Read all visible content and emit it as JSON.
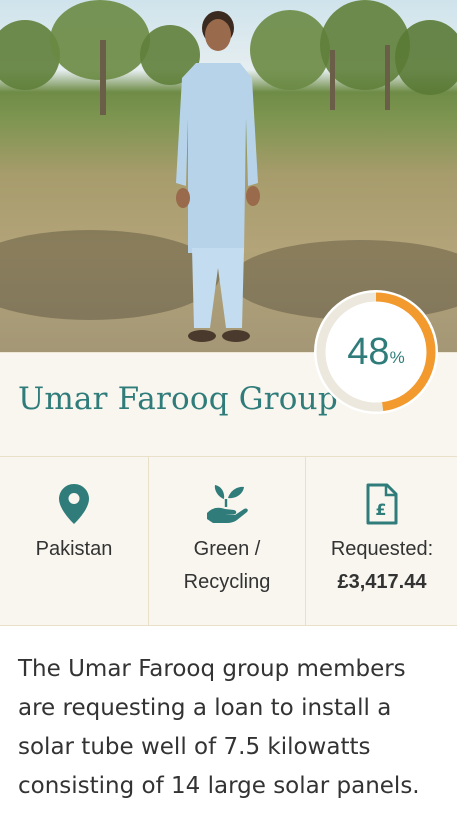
{
  "borrower": {
    "name": "Umar Farooq Group",
    "percent_funded": 48,
    "percent_symbol": "%"
  },
  "stats": {
    "location": {
      "icon": "map-pin-icon",
      "label": "Pakistan"
    },
    "sector": {
      "icon": "hand-leaves-icon",
      "line1": "Green /",
      "line2": "Recycling"
    },
    "amount": {
      "icon": "pound-document-icon",
      "label": "Requested:",
      "value": "£3,417.44"
    }
  },
  "description": "The Umar Farooq group members are requesting a loan to install a solar tube well of 7.5 kilowatts consisting of 14 large solar panels.",
  "colors": {
    "accent_teal": "#2f7c7a",
    "progress_orange": "#f29a2e",
    "panel_cream": "#f9f6ef"
  }
}
